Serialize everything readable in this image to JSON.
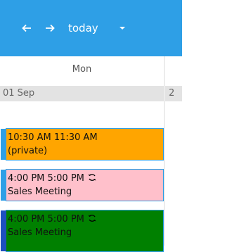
{
  "toolbar": {
    "today_label": "today",
    "prev_icon": "left-arrow",
    "next_icon": "right-arrow",
    "dropdown_icon": "caret-down",
    "bg_color": "#2e9fe6"
  },
  "calendar": {
    "day_header": "Mon",
    "date_label": "01 Sep",
    "next_date_partial": "2"
  },
  "events": [
    {
      "time": "10:30 AM 11:30 AM",
      "title": "(private)",
      "color": "#ffa500",
      "recurring": false
    },
    {
      "time": "4:00 PM 5:00 PM",
      "title": "Sales Meeting",
      "color": "#ffc0cb",
      "recurring": true
    },
    {
      "time": "4:00 PM 5:00 PM",
      "title": "Sales Meeting",
      "color": "#008000",
      "recurring": true
    }
  ]
}
